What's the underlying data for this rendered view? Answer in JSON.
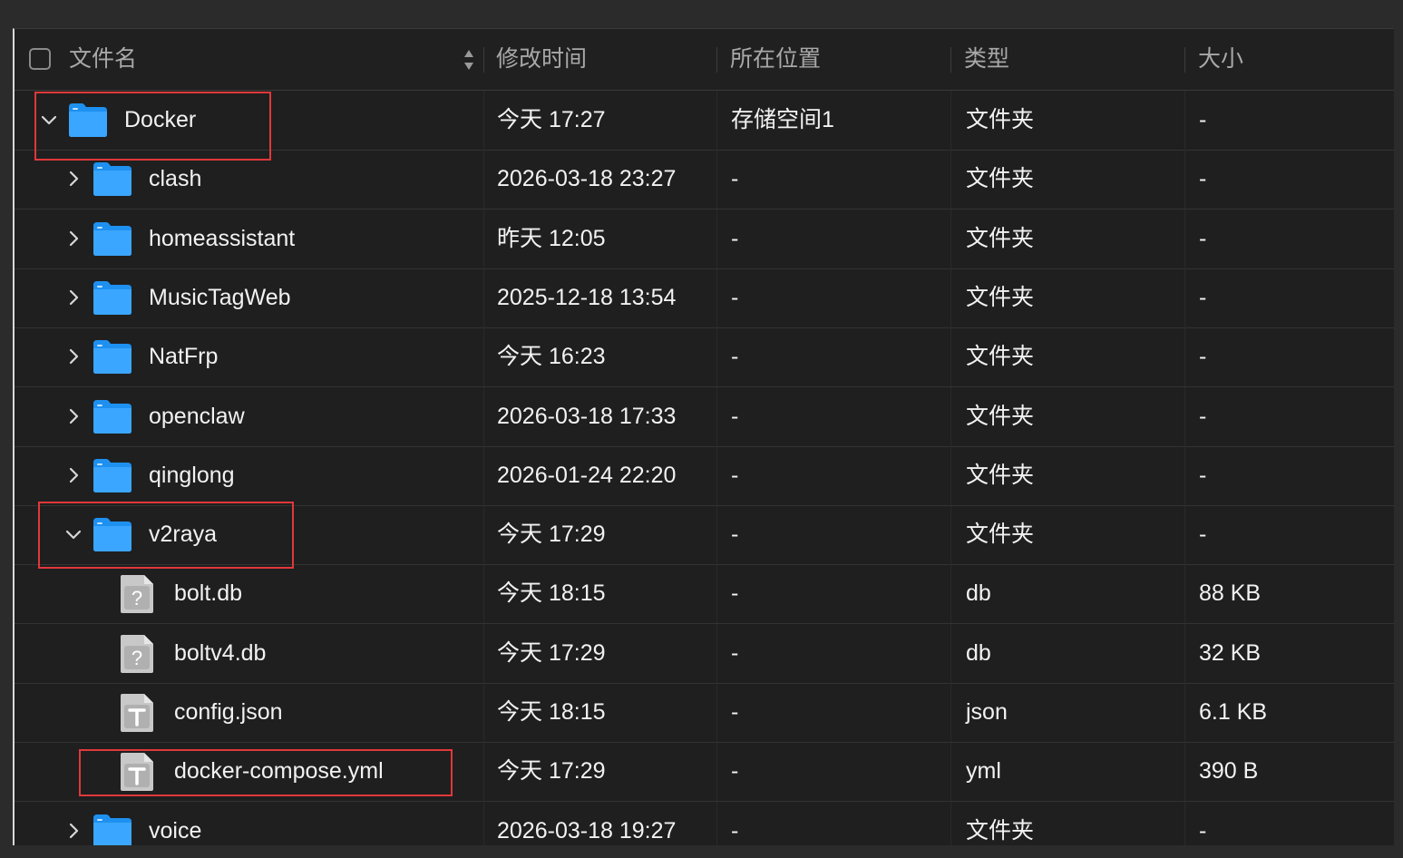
{
  "header": {
    "name_label": "文件名",
    "modified_label": "修改时间",
    "location_label": "所在位置",
    "type_label": "类型",
    "size_label": "大小"
  },
  "rows": [
    {
      "name": "Docker",
      "modified": "今天 17:27",
      "location": "存储空间1",
      "type": "文件夹",
      "size": "-",
      "kind": "folder",
      "depth": 0,
      "expanded": true
    },
    {
      "name": "clash",
      "modified": "2026-03-18 23:27",
      "location": "-",
      "type": "文件夹",
      "size": "-",
      "kind": "folder",
      "depth": 1,
      "expanded": false
    },
    {
      "name": "homeassistant",
      "modified": "昨天 12:05",
      "location": "-",
      "type": "文件夹",
      "size": "-",
      "kind": "folder",
      "depth": 1,
      "expanded": false
    },
    {
      "name": "MusicTagWeb",
      "modified": "2025-12-18 13:54",
      "location": "-",
      "type": "文件夹",
      "size": "-",
      "kind": "folder",
      "depth": 1,
      "expanded": false
    },
    {
      "name": "NatFrp",
      "modified": "今天 16:23",
      "location": "-",
      "type": "文件夹",
      "size": "-",
      "kind": "folder",
      "depth": 1,
      "expanded": false
    },
    {
      "name": "openclaw",
      "modified": "2026-03-18 17:33",
      "location": "-",
      "type": "文件夹",
      "size": "-",
      "kind": "folder",
      "depth": 1,
      "expanded": false
    },
    {
      "name": "qinglong",
      "modified": "2026-01-24 22:20",
      "location": "-",
      "type": "文件夹",
      "size": "-",
      "kind": "folder",
      "depth": 1,
      "expanded": false
    },
    {
      "name": "v2raya",
      "modified": "今天 17:29",
      "location": "-",
      "type": "文件夹",
      "size": "-",
      "kind": "folder",
      "depth": 1,
      "expanded": true
    },
    {
      "name": "bolt.db",
      "modified": "今天 18:15",
      "location": "-",
      "type": "db",
      "size": "88 KB",
      "kind": "unknown",
      "depth": 2
    },
    {
      "name": "boltv4.db",
      "modified": "今天 17:29",
      "location": "-",
      "type": "db",
      "size": "32 KB",
      "kind": "unknown",
      "depth": 2
    },
    {
      "name": "config.json",
      "modified": "今天 18:15",
      "location": "-",
      "type": "json",
      "size": "6.1 KB",
      "kind": "text",
      "depth": 2
    },
    {
      "name": "docker-compose.yml",
      "modified": "今天 17:29",
      "location": "-",
      "type": "yml",
      "size": "390 B",
      "kind": "text",
      "depth": 2
    },
    {
      "name": "voice",
      "modified": "2026-03-18 19:27",
      "location": "-",
      "type": "文件夹",
      "size": "-",
      "kind": "folder",
      "depth": 1,
      "expanded": false
    }
  ],
  "highlighted_rows": [
    0,
    7,
    11
  ],
  "colors": {
    "folder": "#1e90f0",
    "highlight": "#e0383a",
    "file_icon": "#c8c8c8"
  }
}
